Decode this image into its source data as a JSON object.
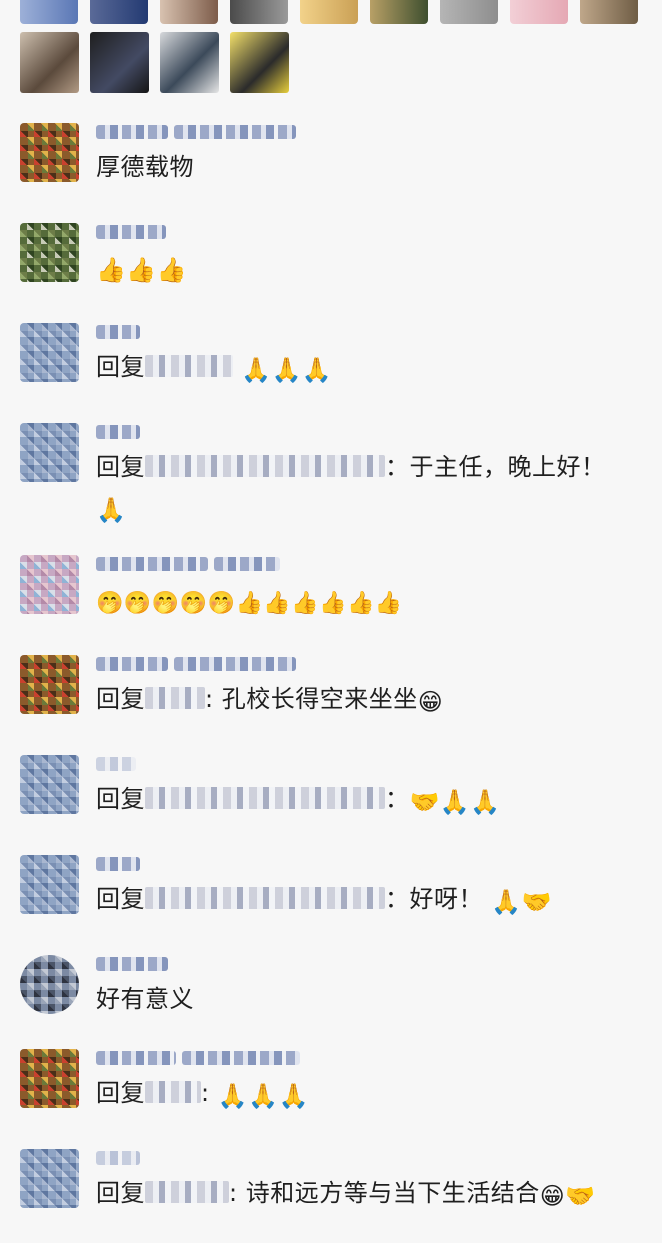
{
  "comments": [
    {
      "text": "厚德载物"
    },
    {
      "emojis": "👍👍👍"
    },
    {
      "reply_prefix": "回复",
      "emojis": "🙏🙏🙏"
    },
    {
      "reply_prefix": "回复",
      "text_after": "：于主任，晚上好！",
      "emojis": "🙏"
    },
    {
      "emojis": "🤭🤭🤭🤭🤭👍👍👍👍👍👍"
    },
    {
      "reply_prefix": "回复",
      "text_after": ": 孔校长得空来坐坐",
      "emojis": "😁"
    },
    {
      "reply_prefix": "回复",
      "text_after": "：",
      "emojis": "🤝🙏🙏"
    },
    {
      "reply_prefix": "回复",
      "text_after": "：好呀！",
      "emojis": "🙏🤝"
    },
    {
      "text": "好有意义"
    },
    {
      "reply_prefix": "回复",
      "text_after": ":",
      "emojis": "🙏🙏🙏"
    },
    {
      "reply_prefix": "回复",
      "text_after": ": 诗和远方等与当下生活结合",
      "emojis": "😁🤝"
    }
  ]
}
